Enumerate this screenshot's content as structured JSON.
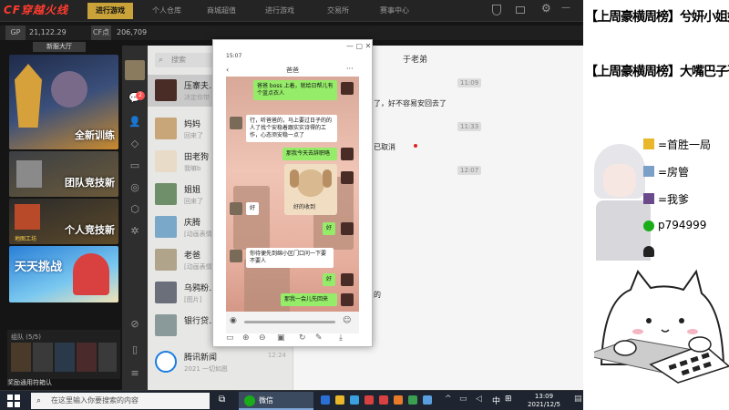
{
  "game": {
    "logo": "CF穿越火线",
    "nav": [
      "进行游戏",
      "个人仓库",
      "商城超值",
      "进行游戏",
      "交易所",
      "赛事中心"
    ],
    "stats": {
      "gp_label": "GP",
      "gp_value": "21,122.29",
      "cf_label": "CF点",
      "cf_value": "206,709"
    },
    "lobby_label": "新服大厅",
    "posters": [
      {
        "title": "全新训练",
        "sub": ""
      },
      {
        "title": "团队竞技新",
        "sub": ""
      },
      {
        "title": "个人竞技新",
        "sub": "地图工坊"
      },
      {
        "title": "天天挑战",
        "sub": ""
      }
    ],
    "squad_label": "组队 (5/5)",
    "bottom_label": "奖励通用符箱认"
  },
  "wechat": {
    "search_placeholder": "搜索",
    "sidebar_badge": "2",
    "chat_title": "于老弟",
    "contacts": [
      {
        "name": "压寨夫...",
        "msg": "决定你带",
        "time": ""
      },
      {
        "name": "妈妈",
        "msg": "回来了",
        "time": ""
      },
      {
        "name": "田老狗",
        "msg": "我嘛b",
        "time": ""
      },
      {
        "name": "姐姐",
        "msg": "回来了",
        "time": ""
      },
      {
        "name": "庆腾",
        "msg": "[动画表情]",
        "time": ""
      },
      {
        "name": "老爸",
        "msg": "[动画表情]",
        "time": ""
      },
      {
        "name": "乌鸦粉...",
        "msg": "[图片]",
        "time": ""
      },
      {
        "name": "银行贷...",
        "msg": "",
        "time": ""
      },
      {
        "name": "腾讯新闻",
        "msg": "2021 一切如愿",
        "time": "12:24"
      }
    ],
    "chat_stamps": [
      "11:09",
      "11:33",
      "12:07"
    ],
    "chat_text": [
      "了，好不容易安回去了",
      "已取消",
      "的"
    ]
  },
  "phone": {
    "status_time": "15:07",
    "chat_name": "爸爸",
    "bubbles": [
      {
        "side": "right",
        "text": "爸爸 boss 上着，就给日帮儿有个蓝点衣人"
      },
      {
        "side": "left",
        "text": "行，听爸爸的，马上要过日子的的人了找个安稳着跟实实诗得的工作，心态须安稳一点了"
      },
      {
        "side": "right",
        "text": "那我今天去辞职咯"
      },
      {
        "side": "left",
        "text": "好"
      },
      {
        "side": "right",
        "text": "好"
      },
      {
        "side": "left",
        "text": "你待便先到绵小区门口问一下要不要人"
      },
      {
        "side": "right",
        "text": "好"
      },
      {
        "side": "right",
        "text": "那我一会儿先回来"
      }
    ],
    "sticker_caption": "好的收到"
  },
  "stream_panel": {
    "lines": [
      "【上周豪横周榜】兮妍小姐姐",
      "【上周豪横周榜】大嘴巴子哥"
    ],
    "legend": [
      {
        "icon": "medal-icon",
        "text": "=首胜一局"
      },
      {
        "icon": "manager-icon",
        "text": "=房管"
      },
      {
        "icon": "dad-icon",
        "text": "=我爹"
      },
      {
        "icon": "wechat-icon",
        "text": "p794999"
      },
      {
        "icon": "qq-icon",
        "text": ""
      }
    ]
  },
  "taskbar": {
    "search_placeholder": "在这里输入你要搜索的内容",
    "active_app": "微信",
    "ime": "中",
    "time": "13:09",
    "date": "2021/12/5"
  }
}
